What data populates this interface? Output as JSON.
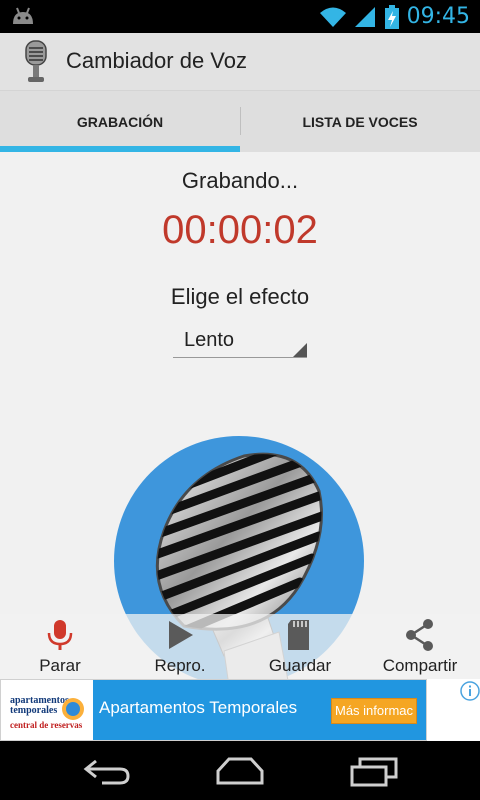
{
  "statusbar": {
    "time": "09:45",
    "icons": [
      "android-icon",
      "wifi-icon",
      "signal-icon",
      "battery-charging-icon"
    ]
  },
  "actionbar": {
    "title": "Cambiador de Voz",
    "icon": "microphone-app-icon"
  },
  "tabs": [
    {
      "label": "GRABACIÓN",
      "active": true
    },
    {
      "label": "LISTA DE VOCES",
      "active": false
    }
  ],
  "recording": {
    "status": "Grabando...",
    "timer": "00:00:02",
    "timer_color": "#c0392b"
  },
  "effect": {
    "label": "Elige el efecto",
    "selected": "Lento"
  },
  "actions": [
    {
      "label": "Parar",
      "icon": "microphone-icon",
      "color": "#d0392b"
    },
    {
      "label": "Repro.",
      "icon": "play-icon",
      "color": "#555555"
    },
    {
      "label": "Guardar",
      "icon": "sd-card-icon",
      "color": "#555555"
    },
    {
      "label": "Compartir",
      "icon": "share-icon",
      "color": "#555555"
    }
  ],
  "ad": {
    "logo_line1": "apartamentos temporales",
    "logo_line2": "central de reservas",
    "title": "Apartamentos Temporales",
    "button": "Más informac",
    "accent": "#2196e0",
    "button_color": "#f5a623"
  },
  "colors": {
    "accent": "#33b5e5",
    "mic_circle": "#3e96dc"
  },
  "navbar": [
    "back-icon",
    "home-icon",
    "recent-apps-icon"
  ]
}
